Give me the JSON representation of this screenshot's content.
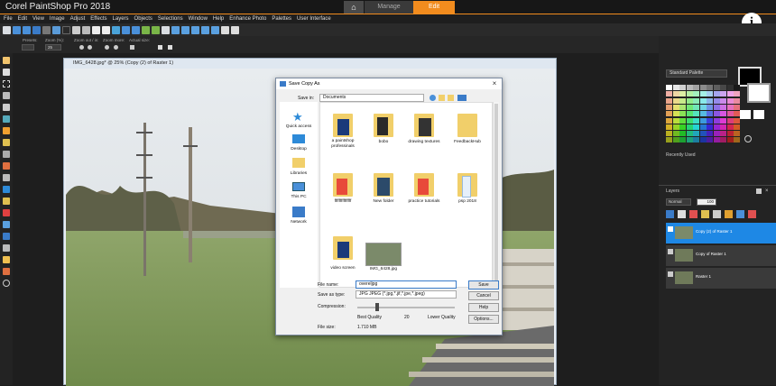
{
  "app": {
    "title": "Corel PaintShop Pro 2018",
    "tabs": {
      "manage": "Manage",
      "edit": "Edit"
    },
    "accent": "#f28c1e"
  },
  "menu": [
    "File",
    "Edit",
    "View",
    "Image",
    "Adjust",
    "Effects",
    "Layers",
    "Objects",
    "Selections",
    "Window",
    "Help",
    "Enhance Photo",
    "Palettes",
    "User Interface"
  ],
  "options": {
    "labels": [
      "Presets:",
      "Zoom (%):",
      "Zoom out / in:",
      "Zoom more:",
      "Actual size:"
    ],
    "zoom": "25"
  },
  "image_window": {
    "title": "IMG_6428.jpg* @ 25% (Copy (2) of Raster 1)"
  },
  "dialog": {
    "title": "Save Copy As",
    "save_in_label": "Save in:",
    "save_in_value": "Documents",
    "places": [
      "Quick access",
      "Desktop",
      "Libraries",
      "This PC",
      "Network"
    ],
    "files": [
      "a paintshop professinals",
      "bobo",
      "drawing textures",
      "FeedbackHub",
      "fffffffffffffff",
      "New folder",
      "practice tutorials",
      "psp 2018",
      "video screen",
      "IMG_6428.jpg"
    ],
    "file_name_label": "File name:",
    "file_name_value": "overeljpg",
    "save_type_label": "Save as type:",
    "save_type_value": "JPG JPEG (*.jpg,*.jif,*.jpe,*.jpeg)",
    "compression_label": "Compression:",
    "compression_value": 20,
    "best_quality": "Best Quality",
    "lower_quality": "Lower Quality",
    "file_size_label": "File size:",
    "file_size_value": "1.710 MB",
    "buttons": {
      "save": "Save",
      "cancel": "Cancel",
      "help": "Help",
      "options": "Options..."
    }
  },
  "right_panel": {
    "palette_select": "Standard Palette",
    "recently_used": "Recently Used",
    "layers_title": "Layers",
    "blend_mode": "Normal",
    "opacity": "100",
    "layers": [
      "Copy (2) of Raster 1",
      "Copy of Raster 1",
      "Raster 1"
    ]
  }
}
